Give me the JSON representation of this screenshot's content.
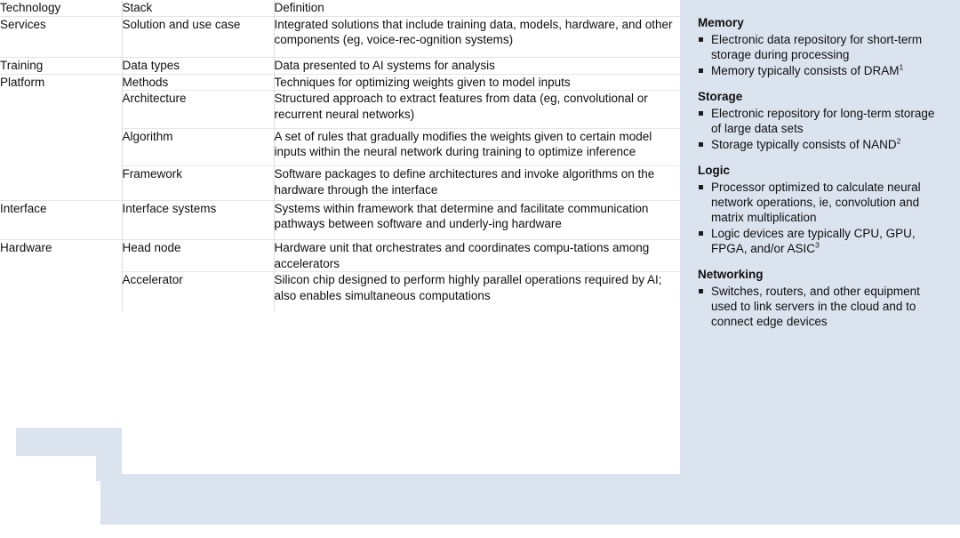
{
  "colors": {
    "highlight": "#dbe3ef",
    "rule": "#e2e4e7",
    "column_rule": "#d9dcdf",
    "text": "#101010"
  },
  "table": {
    "columns": [
      "Technology",
      "Stack",
      "Definition"
    ],
    "rows": [
      {
        "technology": "Services",
        "stack": "Solution and use case",
        "definition": "Integrated solutions that include training data, models, hardware, and other components (eg, voice-rec-ognition systems)",
        "group_start": true,
        "highlight": false
      },
      {
        "technology": "Training",
        "stack": "Data types",
        "definition": "Data presented to AI systems for analysis",
        "group_start": true,
        "highlight": false
      },
      {
        "technology": "Platform",
        "stack": "Methods",
        "definition": "Techniques for optimizing weights given to model inputs",
        "group_start": true,
        "highlight": false
      },
      {
        "technology": "",
        "stack": "Architecture",
        "definition": "Structured approach to extract features from data (eg, convolutional or recurrent neural networks)",
        "group_start": false,
        "highlight": false
      },
      {
        "technology": "",
        "stack": "Algorithm",
        "definition": "A set of rules that gradually modifies the weights given to certain model inputs within the neural network during training to optimize inference",
        "group_start": false,
        "highlight": false
      },
      {
        "technology": "",
        "stack": "Framework",
        "definition": "Software packages to define architectures and invoke algorithms on the hardware through the interface",
        "group_start": false,
        "highlight": false
      },
      {
        "technology": "Interface",
        "stack": "Interface systems",
        "definition": "Systems within framework that determine and facilitate communication pathways between software and underly-ing hardware",
        "group_start": true,
        "highlight": false
      },
      {
        "technology": "Hardware",
        "stack": "Head node",
        "definition": "Hardware unit that orchestrates and coordinates compu-tations among accelerators",
        "group_start": true,
        "highlight": true
      },
      {
        "technology": "",
        "stack": "Accelerator",
        "definition": "Silicon chip designed to perform highly parallel operations required by AI; also enables simultaneous computations",
        "group_start": false,
        "highlight": true
      }
    ]
  },
  "panel": {
    "groups": [
      {
        "heading": "Memory",
        "bullets": [
          "Electronic data repository for short-term storage during processing",
          "Memory typically consists of DRAM"
        ],
        "footnotes": [
          "",
          "1"
        ]
      },
      {
        "heading": "Storage",
        "bullets": [
          "Electronic repository for long-term storage of large data sets",
          "Storage typically consists of NAND"
        ],
        "footnotes": [
          "",
          "2"
        ]
      },
      {
        "heading": "Logic",
        "bullets": [
          "Processor optimized to calculate neural network operations, ie, convolution and matrix multiplication",
          "Logic devices are typically CPU, GPU, FPGA, and/or ASIC"
        ],
        "footnotes": [
          "",
          "3"
        ]
      },
      {
        "heading": "Networking",
        "bullets": [
          "Switches, routers, and other equipment used to link servers in the cloud and to connect edge devices"
        ],
        "footnotes": [
          ""
        ]
      }
    ]
  }
}
